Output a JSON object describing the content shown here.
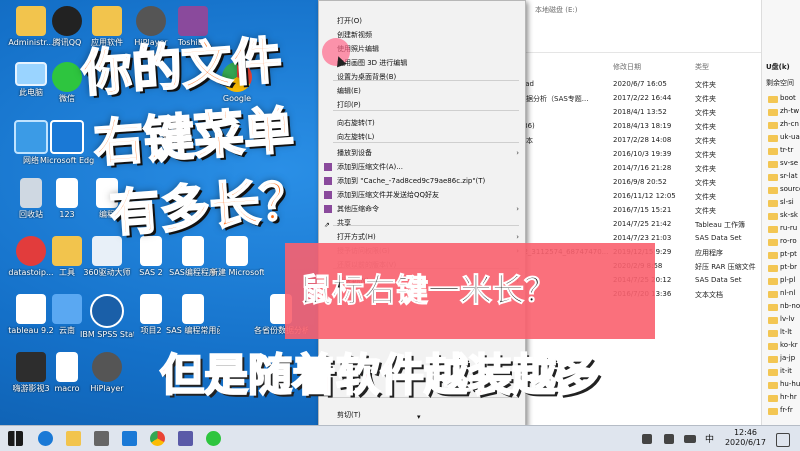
{
  "desktop": {
    "icons_col1": [
      "Administr...",
      "此电脑",
      "网络",
      "回收站",
      "datastoip...",
      "tableau 9.2",
      "嗨游影视3"
    ],
    "icons_col2": [
      "腾讯QQ",
      "微信",
      "Microsoft Edge",
      "123",
      "工具",
      "云南",
      "macro"
    ],
    "icons_col3": [
      "应用软件",
      "",
      "",
      "编程",
      "360驱动大师",
      "IBM SPSS Statistics 20",
      "HiPlayer"
    ],
    "icons_col4": [
      "HiPlayer",
      "",
      "",
      "",
      "SAS 2",
      "项目2",
      ""
    ],
    "icons_col5": [
      "ToshiBa",
      "",
      "Google",
      "",
      "SAS编程程序",
      "SAS 编程常用函数",
      ""
    ],
    "icons_col6": [
      "",
      "",
      "",
      "",
      "新建 Microsoft...",
      "各省份数据分析",
      ""
    ]
  },
  "context_menu": {
    "items": [
      "打开(O)",
      "创建新视频",
      "使用照片编辑",
      "使用画图 3D 进行编辑",
      "设置为桌面背景(B)",
      "编辑(E)",
      "打印(P)",
      "向右旋转(T)",
      "向左旋转(L)",
      "播放到设备",
      "添加到压缩文件(A)...",
      "添加到 \"Cache_-7ad8ced9c79ae86c.zip\"(T)",
      "添加到压缩文件并发送给QQ好友",
      "其他压缩命令",
      "共享",
      "打开方式(H)",
      "授予访问权限(G)",
      "还原以前的版本(V)",
      "发送到(N)",
      "剪切(T)",
      "复制(C)"
    ]
  },
  "explorer": {
    "breadcrumb": "本地磁盘 (E:)",
    "headers": {
      "modified": "修改日期",
      "type": "类型",
      "drive": "U盘(k)"
    },
    "right_heading": "剩余空间",
    "rows": [
      {
        "name": "load",
        "date": "2020/6/7 16:05",
        "type": "文件夹"
      },
      {
        "name": "数据分析（SAS专题...",
        "date": "2017/2/22 16:44",
        "type": "文件夹"
      },
      {
        "name": "",
        "date": "2018/4/1 13:52",
        "type": "文件夹"
      },
      {
        "name": "x86)",
        "date": "2018/4/13 18:19",
        "type": "文件夹"
      },
      {
        "name": "脚本",
        "date": "2017/2/28 14:08",
        "type": "文件夹"
      },
      {
        "name": "",
        "date": "2016/10/3 19:39",
        "type": "文件夹"
      },
      {
        "name": "",
        "date": "2014/7/16 21:28",
        "type": "文件夹"
      },
      {
        "name": "",
        "date": "2016/9/8 20:52",
        "type": "文件夹"
      },
      {
        "name": "",
        "date": "2016/11/12 12:05",
        "type": "文件夹"
      },
      {
        "name": "",
        "date": "2016/7/15 15:21",
        "type": "文件夹"
      },
      {
        "name": "",
        "date": "2014/7/25 21:42",
        "type": "Tableau 工作簿"
      },
      {
        "name": "",
        "date": "2014/7/23 21:03",
        "type": "SAS Data Set"
      },
      {
        "name": "62_3112574_68747470...",
        "date": "2019/12/15 9:29",
        "type": "应用程序"
      },
      {
        "name": "",
        "date": "2020/2/9 8:58",
        "type": "好压 RAR 压缩文件"
      },
      {
        "name": "",
        "date": "2014/7/25 20:12",
        "type": "SAS Data Set"
      },
      {
        "name": "",
        "date": "2016/7/20 13:36",
        "type": "文本文档"
      }
    ],
    "right_items": [
      "boot",
      "zh-tw",
      "zh-cn",
      "uk-ua",
      "tr-tr",
      "sv-se",
      "sr-lat",
      "sources",
      "sl-si",
      "sk-sk",
      "ru-ru",
      "ro-ro",
      "pt-pt",
      "pt-br",
      "pl-pl",
      "nl-nl",
      "nb-no",
      "lv-lv",
      "lt-lt",
      "ko-kr",
      "ja-jp",
      "it-it",
      "hu-hu",
      "hr-hr",
      "fr-fr"
    ]
  },
  "overlay": {
    "line1": "你的文件",
    "line2": "右键菜单",
    "line3": "有多长？",
    "banner": "鼠标右键一米长？",
    "bottom": "但是随着软件越装越多"
  },
  "taskbar": {
    "lang": "中",
    "time": "12:46",
    "date": "2020/6/17"
  },
  "colors": {
    "overlay_orange": "#ff6a14",
    "banner_pink": "#fa616e",
    "bottom_pink": "#ffb8c6",
    "desktop_blue": "#1470c8"
  }
}
